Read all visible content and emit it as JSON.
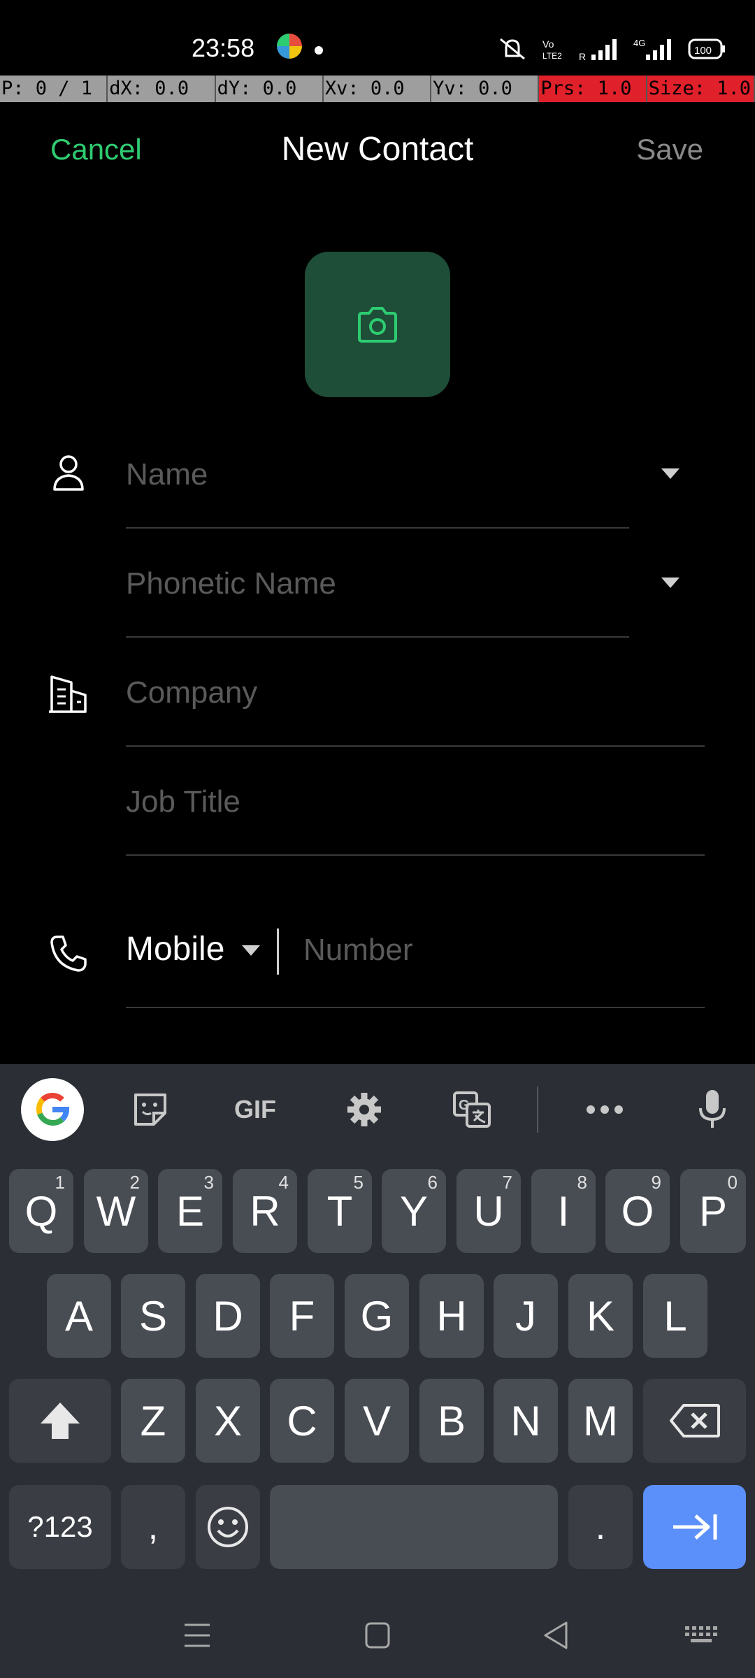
{
  "status": {
    "time": "23:58"
  },
  "debug": {
    "cells": [
      "P: 0 / 1",
      "dX: 0.0",
      "dY: 0.0",
      "Xv: 0.0",
      "Yv: 0.0",
      "Prs: 1.0",
      "Size: 1.0"
    ]
  },
  "header": {
    "cancel": "Cancel",
    "title": "New Contact",
    "save": "Save"
  },
  "avatar": {
    "icon": "camera-icon"
  },
  "form": {
    "name_placeholder": "Name",
    "phonetic_placeholder": "Phonetic Name",
    "company_placeholder": "Company",
    "job_title_placeholder": "Job Title",
    "phone_type": "Mobile",
    "number_placeholder": "Number"
  },
  "keyboard": {
    "toolbar": {
      "gif": "GIF"
    },
    "row1": [
      {
        "k": "Q",
        "h": "1"
      },
      {
        "k": "W",
        "h": "2"
      },
      {
        "k": "E",
        "h": "3"
      },
      {
        "k": "R",
        "h": "4"
      },
      {
        "k": "T",
        "h": "5"
      },
      {
        "k": "Y",
        "h": "6"
      },
      {
        "k": "U",
        "h": "7"
      },
      {
        "k": "I",
        "h": "8"
      },
      {
        "k": "O",
        "h": "9"
      },
      {
        "k": "P",
        "h": "0"
      }
    ],
    "row2": [
      "A",
      "S",
      "D",
      "F",
      "G",
      "H",
      "J",
      "K",
      "L"
    ],
    "row3": [
      "Z",
      "X",
      "C",
      "V",
      "B",
      "N",
      "M"
    ],
    "sym_label": "?123",
    "comma": ",",
    "period": "."
  },
  "colors": {
    "accent": "#2ecc71",
    "avatar_bg": "#1e4d38",
    "enter_key": "#5b8ff9"
  }
}
